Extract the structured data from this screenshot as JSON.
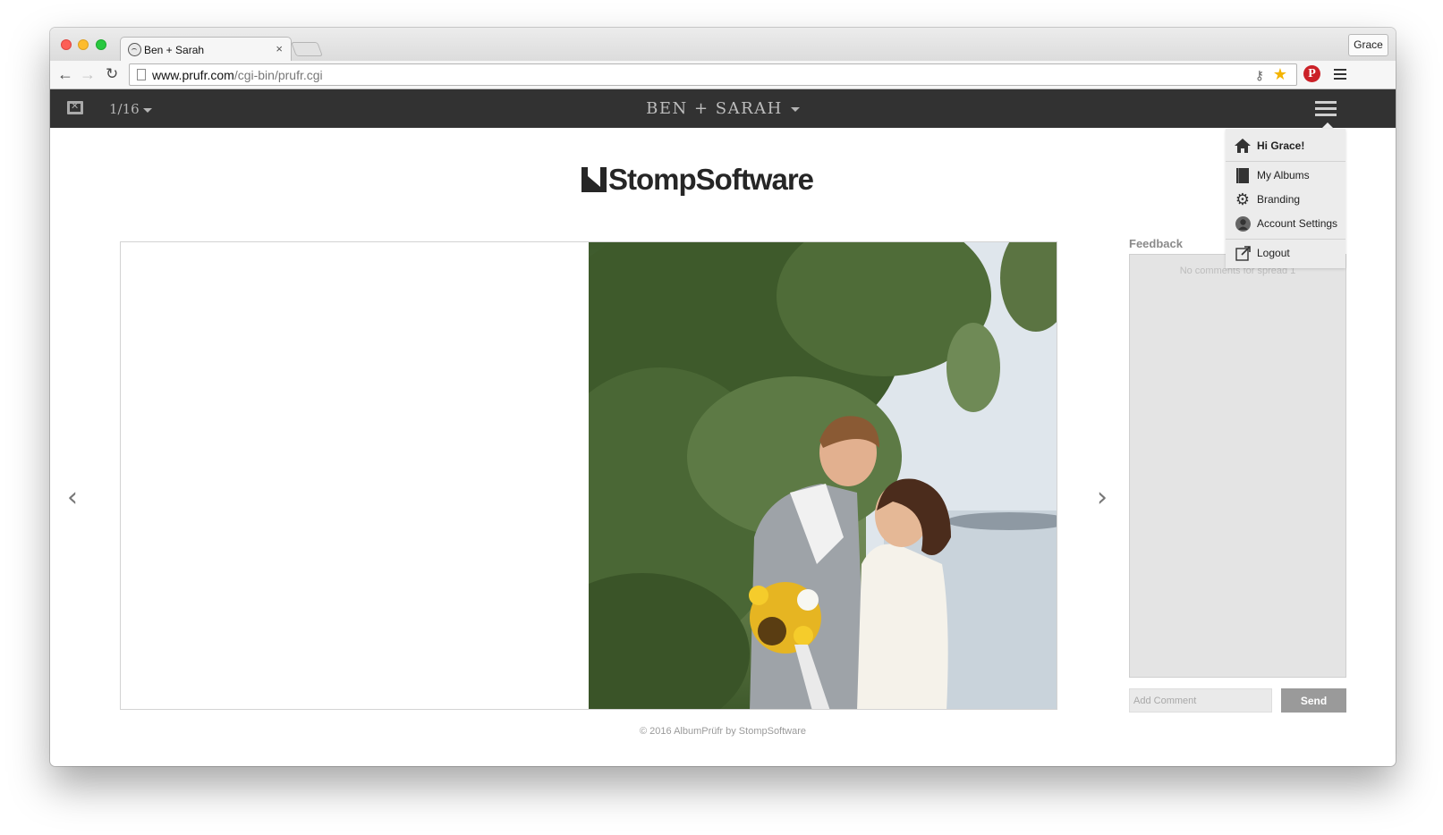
{
  "browser": {
    "tab_title": "Ben + Sarah",
    "tab_close": "×",
    "profile_name": "Grace",
    "url_host": "www.prufr.com",
    "url_path": "/cgi-bin/prufr.cgi"
  },
  "app": {
    "page_counter": "1/16",
    "album_title": "BEN + SARAH",
    "logo_text": "StompSoftware"
  },
  "menu": {
    "greeting": "Hi Grace!",
    "items": [
      {
        "label": "My Albums",
        "icon": "album-icon"
      },
      {
        "label": "Branding",
        "icon": "gear-icon"
      },
      {
        "label": "Account Settings",
        "icon": "user-icon"
      }
    ],
    "logout": "Logout"
  },
  "feedback": {
    "title": "Feedback",
    "empty_text": "No comments for spread 1",
    "input_placeholder": "Add Comment",
    "send_label": "Send"
  },
  "footer": {
    "text": "© 2016 AlbumPrüfr by StompSoftware"
  },
  "colors": {
    "header_bg": "#323232",
    "send_button": "#9a9a9a",
    "pinterest": "#cb2027"
  }
}
